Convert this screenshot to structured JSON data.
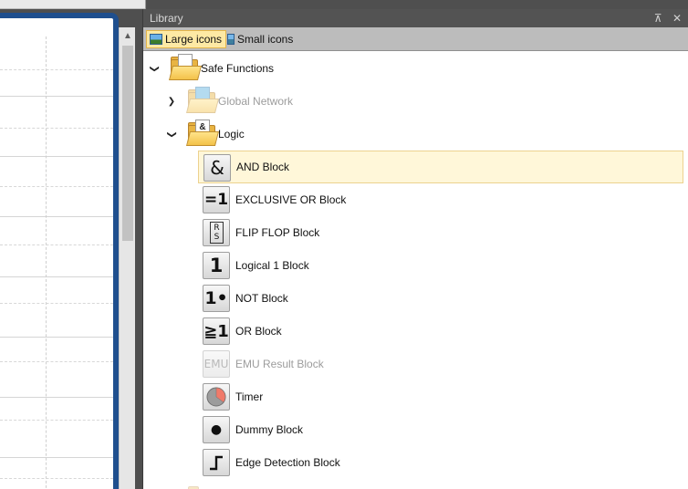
{
  "library": {
    "title": "Library",
    "pin_icon": "pin-icon",
    "close_icon": "close-icon",
    "toolbar": {
      "large_label": "Large icons",
      "small_label": "Small icons"
    },
    "tree": {
      "root": {
        "label": "Safe Functions",
        "icon": "folder-icon"
      },
      "groups": [
        {
          "label": "Global Network",
          "icon": "network-folder-icon",
          "expanded": false,
          "disabled": true
        },
        {
          "label": "Logic",
          "icon": "logic-folder-icon",
          "expanded": true,
          "disabled": false,
          "folder_glyph": "&"
        }
      ],
      "items": [
        {
          "label": "AND Block",
          "glyph": "&",
          "icon": "and-block-icon",
          "selected": true,
          "disabled": false
        },
        {
          "label": "EXCLUSIVE OR Block",
          "glyph": "=1",
          "icon": "xor-block-icon",
          "selected": false,
          "disabled": false
        },
        {
          "label": "FLIP FLOP Block",
          "glyph": "RS",
          "icon": "flip-flop-block-icon",
          "selected": false,
          "disabled": false
        },
        {
          "label": "Logical 1 Block",
          "glyph": "1",
          "icon": "logical-1-block-icon",
          "selected": false,
          "disabled": false
        },
        {
          "label": "NOT Block",
          "glyph": "1•",
          "icon": "not-block-icon",
          "selected": false,
          "disabled": false
        },
        {
          "label": "OR Block",
          "glyph": "≧1",
          "icon": "or-block-icon",
          "selected": false,
          "disabled": false
        },
        {
          "label": "EMU Result Block",
          "glyph": "EMU",
          "icon": "emu-result-block-icon",
          "selected": false,
          "disabled": true
        },
        {
          "label": "Timer",
          "glyph": "",
          "icon": "timer-icon",
          "selected": false,
          "disabled": false
        },
        {
          "label": "Dummy Block",
          "glyph": "●",
          "icon": "dummy-block-icon",
          "selected": false,
          "disabled": false
        },
        {
          "label": "Edge Detection Block",
          "glyph": "",
          "icon": "edge-detection-block-icon",
          "selected": false,
          "disabled": false
        }
      ]
    }
  },
  "colors": {
    "selection_fill": "#fff7d9",
    "selection_border": "#ecd28f",
    "editor_border": "#1f4f8e",
    "panel_title_bg": "#535353"
  }
}
